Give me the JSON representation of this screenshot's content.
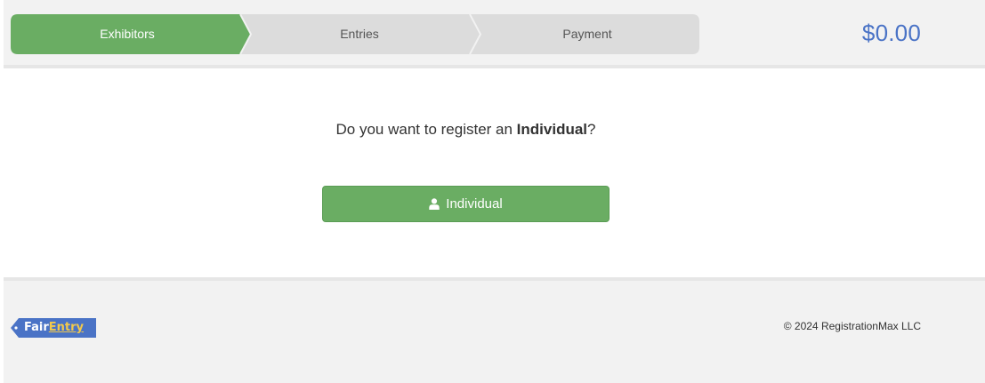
{
  "stepper": {
    "steps": [
      {
        "label": "Exhibitors",
        "state": "active"
      },
      {
        "label": "Entries",
        "state": "inactive"
      },
      {
        "label": "Payment",
        "state": "inactive"
      }
    ],
    "active_color": "#6aad63",
    "inactive_color": "#dcdcdc"
  },
  "cart": {
    "total": "$0.00",
    "color": "#4a73c6"
  },
  "main": {
    "question_prefix": "Do you want to register an ",
    "question_bold": "Individual",
    "question_suffix": "?",
    "individual_button": {
      "label": "Individual",
      "icon": "user-icon",
      "color": "#6aad63"
    }
  },
  "footer": {
    "logo_fair": "Fair",
    "logo_entry": "Entry",
    "logo_color": "#4a73c6",
    "copyright": "© 2024 RegistrationMax LLC"
  }
}
